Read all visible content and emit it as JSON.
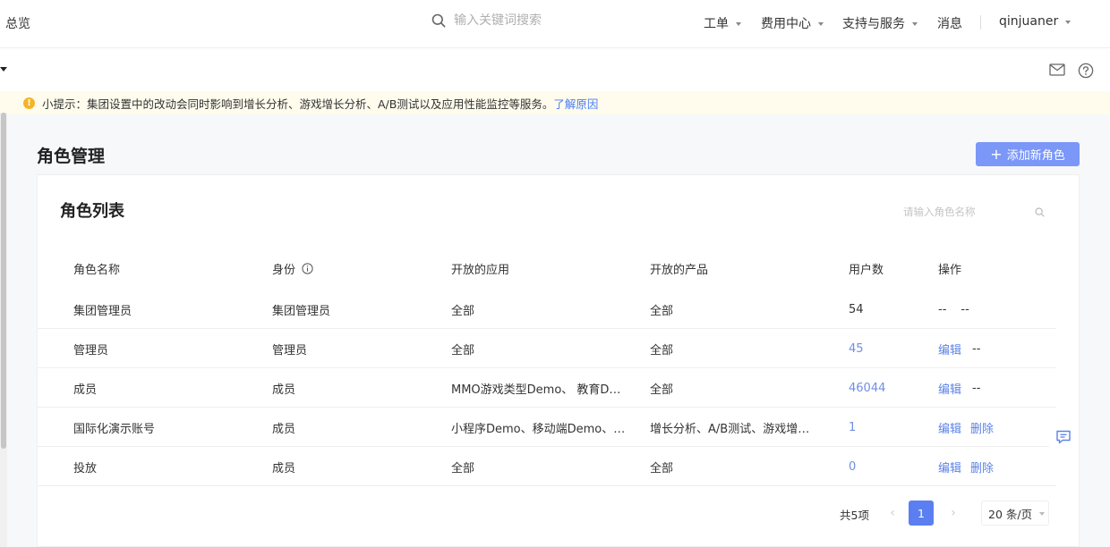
{
  "topbar": {
    "overview": "总览",
    "search_placeholder": "输入关键词搜索",
    "nav": [
      {
        "label": "工单"
      },
      {
        "label": "费用中心"
      },
      {
        "label": "支持与服务"
      },
      {
        "label": "消息"
      }
    ],
    "user": "qinjuaner"
  },
  "notice": {
    "text": "小提示：集团设置中的改动会同时影响到增长分析、游戏增长分析、A/B测试以及应用性能监控等服务。",
    "link": "了解原因"
  },
  "page": {
    "title": "角色管理",
    "add_button": "添加新角色"
  },
  "card": {
    "title": "角色列表",
    "search_placeholder": "请输入角色名称"
  },
  "table": {
    "columns": [
      "角色名称",
      "身份",
      "开放的应用",
      "开放的产品",
      "用户数",
      "操作"
    ],
    "rows": [
      {
        "name": "集团管理员",
        "identity": "集团管理员",
        "apps": "全部",
        "products": "全部",
        "users": "54",
        "op1": "--",
        "op2": "--"
      },
      {
        "name": "管理员",
        "identity": "管理员",
        "apps": "全部",
        "products": "全部",
        "users": "45",
        "op1": "编辑",
        "op2": "--"
      },
      {
        "name": "成员",
        "identity": "成员",
        "apps": "MMO游戏类型Demo、 教育D…",
        "products": "全部",
        "users": "46044",
        "op1": "编辑",
        "op2": "--"
      },
      {
        "name": "国际化演示账号",
        "identity": "成员",
        "apps": "小程序Demo、移动端Demo、…",
        "products": "增长分析、A/B测试、游戏增…",
        "users": "1",
        "op1": "编辑",
        "op2": "删除"
      },
      {
        "name": "投放",
        "identity": "成员",
        "apps": "全部",
        "products": "全部",
        "users": "0",
        "op1": "编辑",
        "op2": "删除"
      }
    ]
  },
  "pagination": {
    "total": "共5项",
    "current": "1",
    "page_size": "20 条/页"
  },
  "colors": {
    "accent": "#5b7ff0",
    "button": "#7b97f8",
    "link": "#5b82e8",
    "warning": "#f5b427"
  }
}
